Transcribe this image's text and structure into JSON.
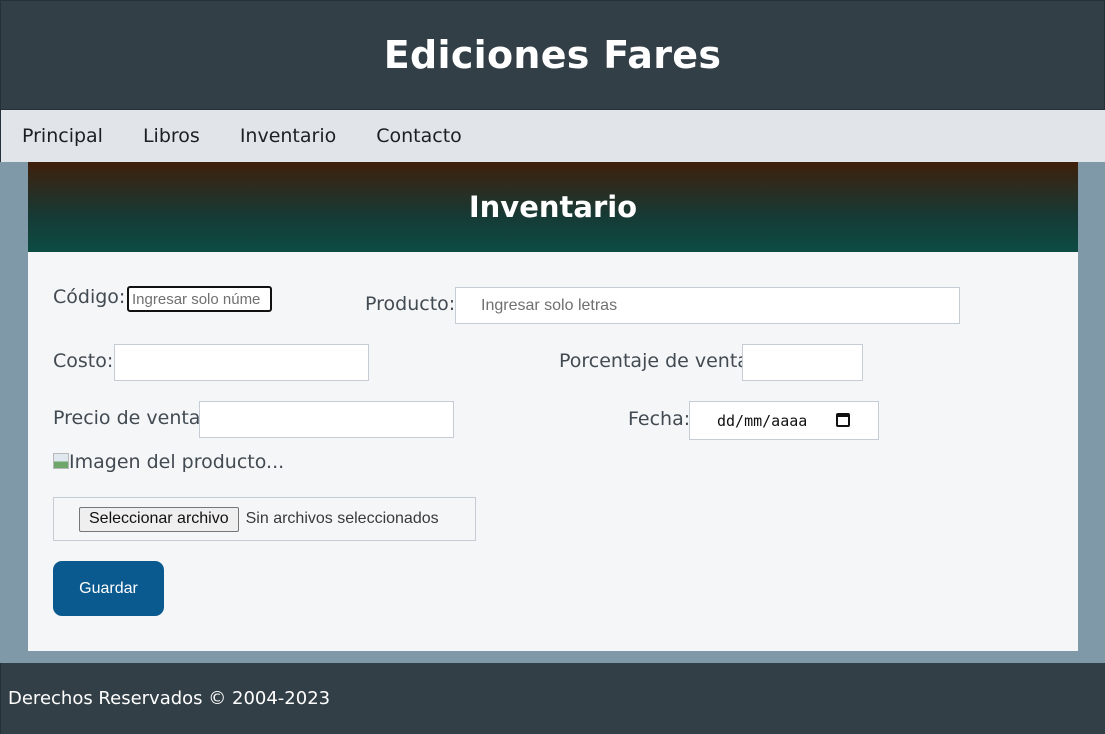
{
  "header": {
    "title": "Ediciones Fares"
  },
  "nav": {
    "items": [
      "Principal",
      "Libros",
      "Inventario",
      "Contacto"
    ]
  },
  "card": {
    "title": "Inventario"
  },
  "form": {
    "codigo": {
      "label": "Código:",
      "placeholder": "Ingresar solo núme",
      "value": ""
    },
    "producto": {
      "label": "Producto:",
      "placeholder": "Ingresar solo letras",
      "value": ""
    },
    "costo": {
      "label": "Costo:",
      "value": ""
    },
    "porcentaje": {
      "label": "Porcentaje de venta:",
      "value": ""
    },
    "precio": {
      "label": "Precio de venta:",
      "value": ""
    },
    "fecha": {
      "label": "Fecha:",
      "value": "dd/mm/aaaa",
      "icon": "calendar-icon"
    },
    "imagen": {
      "alt_text": "Imagen del producto...",
      "icon": "broken-image-icon"
    },
    "archivo": {
      "button_label": "Seleccionar archivo",
      "status": "Sin archivos seleccionados"
    },
    "guardar_label": "Guardar"
  },
  "footer": {
    "text": "Derechos Reservados © 2004-2023"
  },
  "colors": {
    "header_bg": "#323f47",
    "nav_bg": "#e1e5ea",
    "page_bg": "#7f99a8",
    "card_bg": "#f5f6f8",
    "save_button": "#0a5a8f"
  }
}
